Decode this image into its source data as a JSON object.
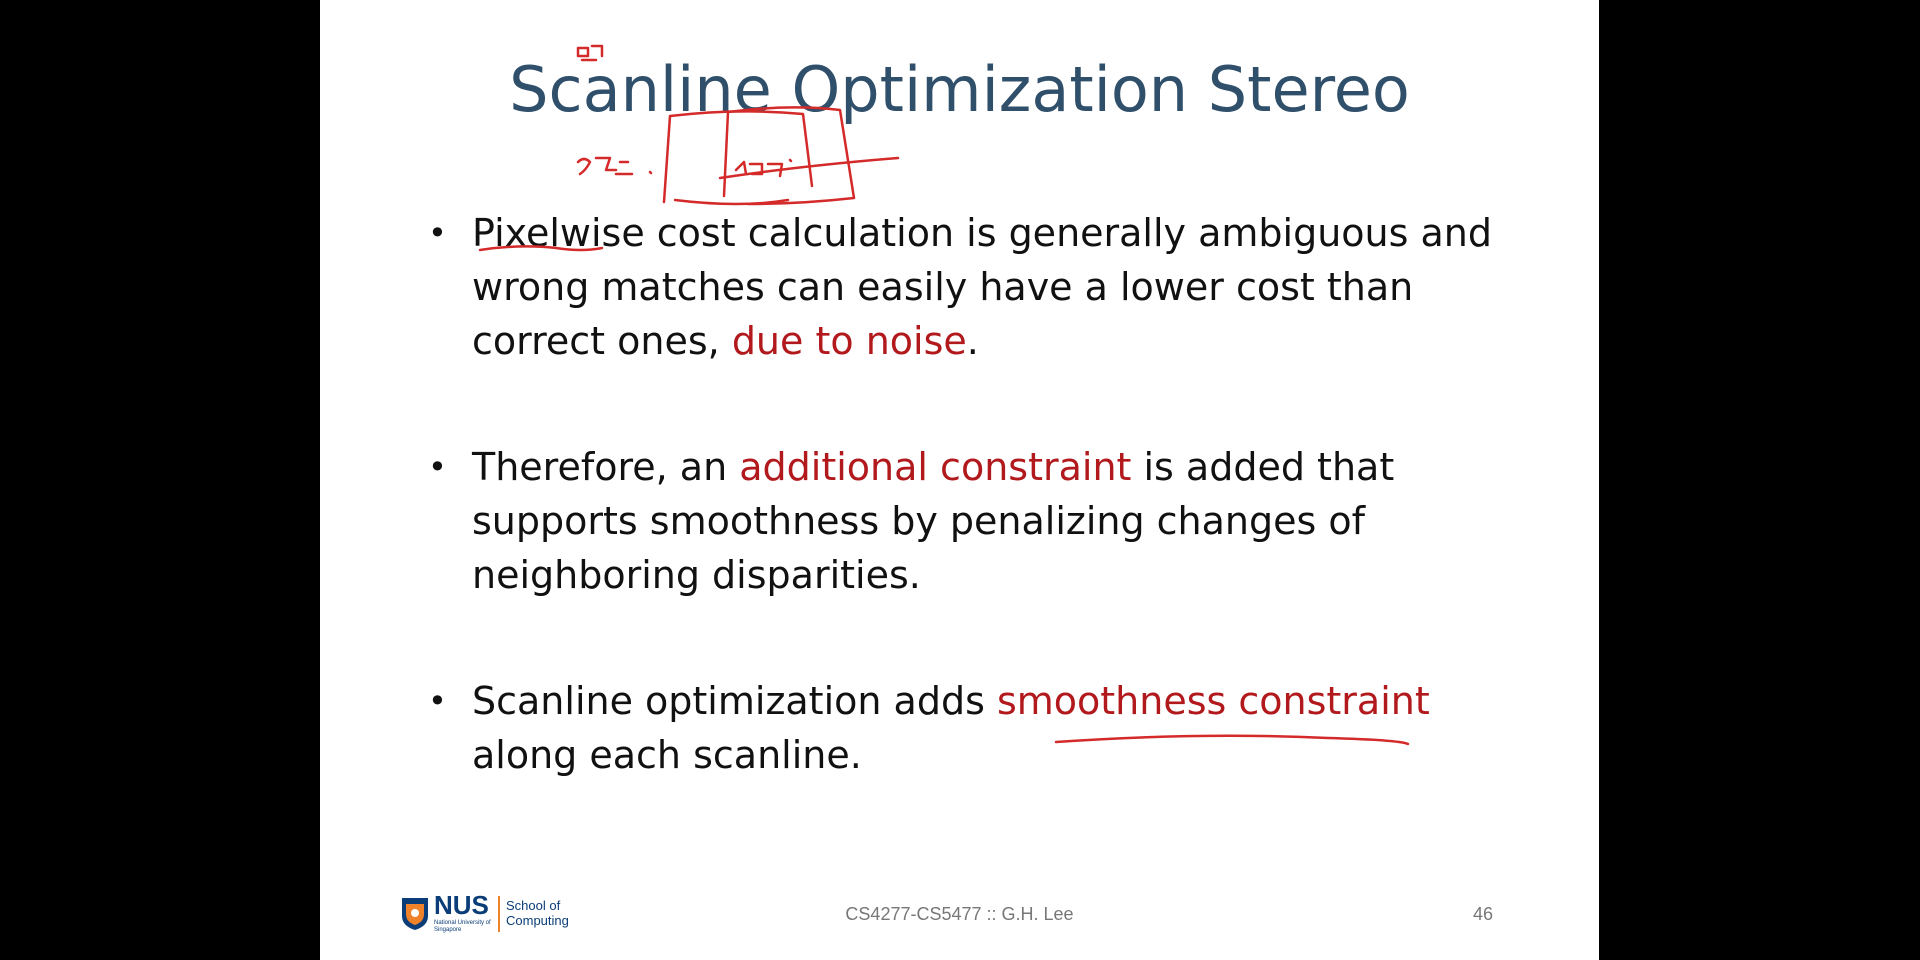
{
  "slide": {
    "title": "Scanline Optimization Stereo",
    "bullets": [
      {
        "parts": [
          {
            "text": "Pixelwise cost calculation is generally ambiguous and wrong matches can easily have a lower cost than correct ones, ",
            "accent": false
          },
          {
            "text": "due to noise",
            "accent": true
          },
          {
            "text": ".",
            "accent": false
          }
        ]
      },
      {
        "parts": [
          {
            "text": "Therefore, an ",
            "accent": false
          },
          {
            "text": "additional constraint",
            "accent": true
          },
          {
            "text": " is added that supports smoothness by penalizing changes of neighboring disparities.",
            "accent": false
          }
        ]
      },
      {
        "parts": [
          {
            "text": "Scanline optimization adds ",
            "accent": false
          },
          {
            "text": "smoothness constraint",
            "accent": true
          },
          {
            "text": " along each scanline.",
            "accent": false
          }
        ]
      }
    ],
    "footer": {
      "course": "CS4277-CS5477 :: G.H. Lee",
      "page_number": "46",
      "logo": {
        "mark": "NUS",
        "sub": "National University of Singapore",
        "school": "School of Computing",
        "crest_icon": "nus-crest-icon"
      }
    }
  },
  "colors": {
    "title": "#2f4f6a",
    "text": "#111111",
    "accent": "#b2191c",
    "ink": "#d42a2a",
    "letterbox": "#000000"
  }
}
